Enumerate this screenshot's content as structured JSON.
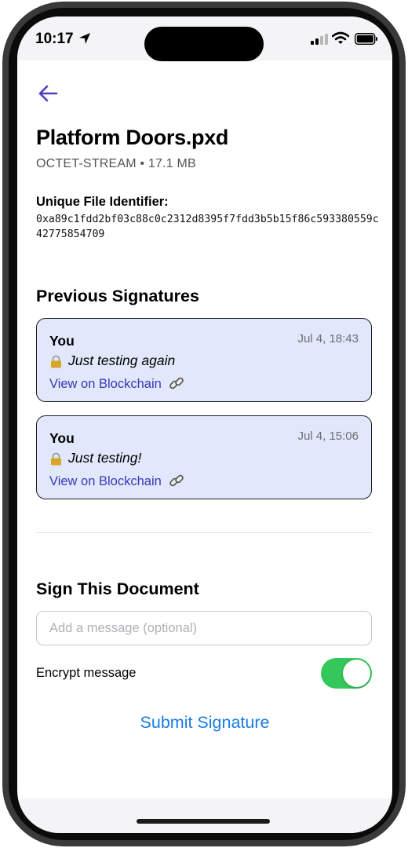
{
  "status_bar": {
    "time": "10:17"
  },
  "header": {
    "title": "Platform Doors.pxd",
    "file_type": "OCTET-STREAM",
    "separator": "•",
    "file_size": "17.1 MB"
  },
  "identifier": {
    "label": "Unique File Identifier:",
    "value": "0xa89c1fdd2bf03c88c0c2312d8395f7fdd3b5b15f86c593380559c42775854709"
  },
  "previous_signatures": {
    "title": "Previous Signatures",
    "items": [
      {
        "author": "You",
        "date": "Jul 4, 18:43",
        "message": "Just testing again",
        "link_label": "View on Blockchain"
      },
      {
        "author": "You",
        "date": "Jul 4, 15:06",
        "message": "Just testing!",
        "link_label": "View on Blockchain"
      }
    ]
  },
  "sign": {
    "title": "Sign This Document",
    "message_placeholder": "Add a message (optional)",
    "message_value": "",
    "encrypt_label": "Encrypt message",
    "encrypt_enabled": true,
    "submit_label": "Submit Signature"
  },
  "colors": {
    "accent": "#1a7ce0",
    "link": "#3a36b8",
    "card_background": "#e1e8fb",
    "toggle_on": "#34c759",
    "back_arrow": "#4a3fc9"
  },
  "icons": {
    "back": "arrow-left-icon",
    "lock": "lock-icon",
    "link": "chain-link-icon",
    "location": "location-arrow-icon",
    "signal": "cellular-signal-icon",
    "wifi": "wifi-icon",
    "battery": "battery-icon"
  }
}
